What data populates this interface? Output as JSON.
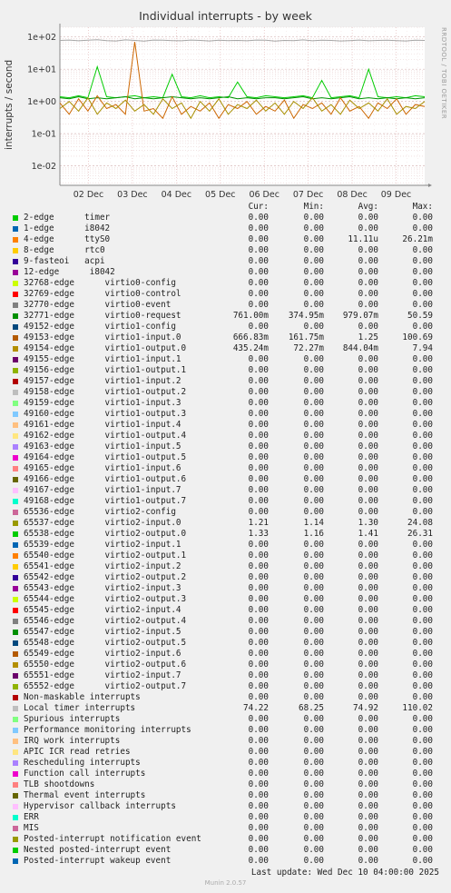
{
  "chart_data": {
    "type": "line",
    "title": "Individual interrupts - by week",
    "ylabel": "interrupts / second",
    "yscale": "log",
    "ylim": [
      0.0025,
      200
    ],
    "y_ticks": [
      {
        "value": 100,
        "label": "1e+02"
      },
      {
        "value": 10,
        "label": "1e+01"
      },
      {
        "value": 1,
        "label": "1e+00"
      },
      {
        "value": 0.1,
        "label": "1e-01"
      },
      {
        "value": 0.01,
        "label": "1e-02"
      }
    ],
    "x_ticks": [
      "02 Dec",
      "03 Dec",
      "04 Dec",
      "05 Dec",
      "06 Dec",
      "07 Dec",
      "08 Dec",
      "09 Dec"
    ],
    "grid": true,
    "series": [
      {
        "name": "Local timer interrupts",
        "color": "#a6a6a6",
        "values": [
          78,
          80,
          76,
          79,
          82,
          77,
          75,
          81,
          78,
          74,
          80,
          79,
          77,
          76,
          80,
          78,
          75,
          79,
          77,
          78,
          76,
          80,
          79,
          74,
          78,
          77,
          81,
          76,
          79,
          78,
          75,
          77,
          80,
          76,
          78,
          79,
          77,
          75,
          79,
          78
        ]
      },
      {
        "name": "65538-edge",
        "color": "#00cc00",
        "values": [
          1.4,
          1.3,
          1.5,
          1.3,
          12,
          1.4,
          1.3,
          1.4,
          1.5,
          1.3,
          1.4,
          1.3,
          7,
          1.4,
          1.3,
          1.5,
          1.3,
          1.4,
          1.3,
          4,
          1.4,
          1.3,
          1.5,
          1.4,
          1.3,
          1.4,
          1.5,
          1.3,
          4.5,
          1.3,
          1.4,
          1.5,
          1.3,
          10,
          1.4,
          1.3,
          1.4,
          1.3,
          1.5,
          1.4
        ]
      },
      {
        "name": "65537-edge",
        "color": "#008f00",
        "values": [
          1.3,
          1.2,
          1.4,
          1.2,
          1.3,
          1.2,
          1.3,
          1.4,
          1.2,
          1.3,
          1.2,
          1.3,
          1.4,
          1.3,
          1.2,
          1.3,
          1.2,
          1.3,
          1.4,
          1.2,
          1.3,
          1.2,
          1.3,
          1.3,
          1.2,
          1.3,
          1.4,
          1.2,
          1.3,
          1.2,
          1.3,
          1.4,
          1.2,
          1.3,
          1.2,
          1.3,
          1.2,
          1.3,
          1.2,
          1.3
        ]
      },
      {
        "name": "49153-edge",
        "color": "#cc6600",
        "values": [
          0.9,
          0.4,
          1.2,
          0.5,
          1.5,
          0.6,
          0.8,
          0.4,
          70,
          0.5,
          0.6,
          0.3,
          1.4,
          0.4,
          0.7,
          0.5,
          0.9,
          0.3,
          0.8,
          0.6,
          1.0,
          0.4,
          0.7,
          0.5,
          1.1,
          0.3,
          0.8,
          0.6,
          0.9,
          0.4,
          1.3,
          0.5,
          0.7,
          0.3,
          0.9,
          0.6,
          1.2,
          0.4,
          0.8,
          0.7
        ]
      },
      {
        "name": "49154-edge",
        "color": "#a88f00",
        "values": [
          0.6,
          1.0,
          0.5,
          1.3,
          0.4,
          0.9,
          0.6,
          1.1,
          0.5,
          0.8,
          0.4,
          1.2,
          0.6,
          0.9,
          0.3,
          1.0,
          0.5,
          1.2,
          0.4,
          0.8,
          0.6,
          1.1,
          0.5,
          0.9,
          0.4,
          1.0,
          0.6,
          1.3,
          0.5,
          0.8,
          0.4,
          1.1,
          0.6,
          0.9,
          0.5,
          1.2,
          0.4,
          0.7,
          0.6,
          1.0
        ]
      },
      {
        "name": "4-edge",
        "color": "#ff8800",
        "values": [
          0,
          0,
          0,
          0,
          0,
          0,
          0,
          0,
          0,
          0.005,
          0,
          0,
          0,
          0,
          0,
          0,
          0,
          0,
          0,
          0,
          0,
          0,
          0,
          0,
          0,
          0,
          0,
          0,
          0,
          0,
          0,
          0,
          0,
          0,
          0,
          0,
          0,
          0,
          0,
          0
        ]
      }
    ]
  },
  "side_text": "RRDTOOL / TOBI OETIKER",
  "legend": {
    "headers": {
      "cur": "Cur:",
      "min": "Min:",
      "avg": "Avg:",
      "max": "Max:"
    },
    "rows": [
      {
        "color": "#00cc00",
        "name": "2-edge      timer",
        "cur": "0.00",
        "min": "0.00",
        "avg": "0.00",
        "max": "0.00"
      },
      {
        "color": "#0066b3",
        "name": "1-edge      i8042",
        "cur": "0.00",
        "min": "0.00",
        "avg": "0.00",
        "max": "0.00"
      },
      {
        "color": "#ff8000",
        "name": "4-edge      ttyS0",
        "cur": "0.00",
        "min": "0.00",
        "avg": "11.11u",
        "max": "26.21m"
      },
      {
        "color": "#ffcc00",
        "name": "8-edge      rtc0",
        "cur": "0.00",
        "min": "0.00",
        "avg": "0.00",
        "max": "0.00"
      },
      {
        "color": "#330099",
        "name": "9-fasteoi   acpi",
        "cur": "0.00",
        "min": "0.00",
        "avg": "0.00",
        "max": "0.00"
      },
      {
        "color": "#990099",
        "name": "12-edge      i8042",
        "cur": "0.00",
        "min": "0.00",
        "avg": "0.00",
        "max": "0.00"
      },
      {
        "color": "#ccff00",
        "name": "32768-edge      virtio0-config",
        "cur": "0.00",
        "min": "0.00",
        "avg": "0.00",
        "max": "0.00"
      },
      {
        "color": "#ff0000",
        "name": "32769-edge      virtio0-control",
        "cur": "0.00",
        "min": "0.00",
        "avg": "0.00",
        "max": "0.00"
      },
      {
        "color": "#808080",
        "name": "32770-edge      virtio0-event",
        "cur": "0.00",
        "min": "0.00",
        "avg": "0.00",
        "max": "0.00"
      },
      {
        "color": "#008f00",
        "name": "32771-edge      virtio0-request",
        "cur": "761.00m",
        "min": "374.95m",
        "avg": "979.07m",
        "max": "50.59"
      },
      {
        "color": "#00487d",
        "name": "49152-edge      virtio1-config",
        "cur": "0.00",
        "min": "0.00",
        "avg": "0.00",
        "max": "0.00"
      },
      {
        "color": "#b35a00",
        "name": "49153-edge      virtio1-input.0",
        "cur": "666.83m",
        "min": "161.75m",
        "avg": "1.25",
        "max": "100.69"
      },
      {
        "color": "#b38f00",
        "name": "49154-edge      virtio1-output.0",
        "cur": "435.24m",
        "min": "72.27m",
        "avg": "844.04m",
        "max": "7.94"
      },
      {
        "color": "#6b006b",
        "name": "49155-edge      virtio1-input.1",
        "cur": "0.00",
        "min": "0.00",
        "avg": "0.00",
        "max": "0.00"
      },
      {
        "color": "#8fb300",
        "name": "49156-edge      virtio1-output.1",
        "cur": "0.00",
        "min": "0.00",
        "avg": "0.00",
        "max": "0.00"
      },
      {
        "color": "#b30000",
        "name": "49157-edge      virtio1-input.2",
        "cur": "0.00",
        "min": "0.00",
        "avg": "0.00",
        "max": "0.00"
      },
      {
        "color": "#bebebe",
        "name": "49158-edge      virtio1-output.2",
        "cur": "0.00",
        "min": "0.00",
        "avg": "0.00",
        "max": "0.00"
      },
      {
        "color": "#80ff80",
        "name": "49159-edge      virtio1-input.3",
        "cur": "0.00",
        "min": "0.00",
        "avg": "0.00",
        "max": "0.00"
      },
      {
        "color": "#80c9ff",
        "name": "49160-edge      virtio1-output.3",
        "cur": "0.00",
        "min": "0.00",
        "avg": "0.00",
        "max": "0.00"
      },
      {
        "color": "#ffc080",
        "name": "49161-edge      virtio1-input.4",
        "cur": "0.00",
        "min": "0.00",
        "avg": "0.00",
        "max": "0.00"
      },
      {
        "color": "#ffe680",
        "name": "49162-edge      virtio1-output.4",
        "cur": "0.00",
        "min": "0.00",
        "avg": "0.00",
        "max": "0.00"
      },
      {
        "color": "#aa80ff",
        "name": "49163-edge      virtio1-input.5",
        "cur": "0.00",
        "min": "0.00",
        "avg": "0.00",
        "max": "0.00"
      },
      {
        "color": "#ee00cc",
        "name": "49164-edge      virtio1-output.5",
        "cur": "0.00",
        "min": "0.00",
        "avg": "0.00",
        "max": "0.00"
      },
      {
        "color": "#ff8080",
        "name": "49165-edge      virtio1-input.6",
        "cur": "0.00",
        "min": "0.00",
        "avg": "0.00",
        "max": "0.00"
      },
      {
        "color": "#666600",
        "name": "49166-edge      virtio1-output.6",
        "cur": "0.00",
        "min": "0.00",
        "avg": "0.00",
        "max": "0.00"
      },
      {
        "color": "#ffbfff",
        "name": "49167-edge      virtio1-input.7",
        "cur": "0.00",
        "min": "0.00",
        "avg": "0.00",
        "max": "0.00"
      },
      {
        "color": "#00ffcc",
        "name": "49168-edge      virtio1-output.7",
        "cur": "0.00",
        "min": "0.00",
        "avg": "0.00",
        "max": "0.00"
      },
      {
        "color": "#cc6699",
        "name": "65536-edge      virtio2-config",
        "cur": "0.00",
        "min": "0.00",
        "avg": "0.00",
        "max": "0.00"
      },
      {
        "color": "#999900",
        "name": "65537-edge      virtio2-input.0",
        "cur": "1.21",
        "min": "1.14",
        "avg": "1.30",
        "max": "24.08"
      },
      {
        "color": "#00cc00",
        "name": "65538-edge      virtio2-output.0",
        "cur": "1.33",
        "min": "1.16",
        "avg": "1.41",
        "max": "26.31"
      },
      {
        "color": "#0066b3",
        "name": "65539-edge      virtio2-input.1",
        "cur": "0.00",
        "min": "0.00",
        "avg": "0.00",
        "max": "0.00"
      },
      {
        "color": "#ff8000",
        "name": "65540-edge      virtio2-output.1",
        "cur": "0.00",
        "min": "0.00",
        "avg": "0.00",
        "max": "0.00"
      },
      {
        "color": "#ffcc00",
        "name": "65541-edge      virtio2-input.2",
        "cur": "0.00",
        "min": "0.00",
        "avg": "0.00",
        "max": "0.00"
      },
      {
        "color": "#330099",
        "name": "65542-edge      virtio2-output.2",
        "cur": "0.00",
        "min": "0.00",
        "avg": "0.00",
        "max": "0.00"
      },
      {
        "color": "#990099",
        "name": "65543-edge      virtio2-input.3",
        "cur": "0.00",
        "min": "0.00",
        "avg": "0.00",
        "max": "0.00"
      },
      {
        "color": "#ccff00",
        "name": "65544-edge      virtio2-output.3",
        "cur": "0.00",
        "min": "0.00",
        "avg": "0.00",
        "max": "0.00"
      },
      {
        "color": "#ff0000",
        "name": "65545-edge      virtio2-input.4",
        "cur": "0.00",
        "min": "0.00",
        "avg": "0.00",
        "max": "0.00"
      },
      {
        "color": "#808080",
        "name": "65546-edge      virtio2-output.4",
        "cur": "0.00",
        "min": "0.00",
        "avg": "0.00",
        "max": "0.00"
      },
      {
        "color": "#008f00",
        "name": "65547-edge      virtio2-input.5",
        "cur": "0.00",
        "min": "0.00",
        "avg": "0.00",
        "max": "0.00"
      },
      {
        "color": "#00487d",
        "name": "65548-edge      virtio2-output.5",
        "cur": "0.00",
        "min": "0.00",
        "avg": "0.00",
        "max": "0.00"
      },
      {
        "color": "#b35a00",
        "name": "65549-edge      virtio2-input.6",
        "cur": "0.00",
        "min": "0.00",
        "avg": "0.00",
        "max": "0.00"
      },
      {
        "color": "#b38f00",
        "name": "65550-edge      virtio2-output.6",
        "cur": "0.00",
        "min": "0.00",
        "avg": "0.00",
        "max": "0.00"
      },
      {
        "color": "#6b006b",
        "name": "65551-edge      virtio2-input.7",
        "cur": "0.00",
        "min": "0.00",
        "avg": "0.00",
        "max": "0.00"
      },
      {
        "color": "#8fb300",
        "name": "65552-edge      virtio2-output.7",
        "cur": "0.00",
        "min": "0.00",
        "avg": "0.00",
        "max": "0.00"
      },
      {
        "color": "#b30000",
        "name": "Non-maskable interrupts",
        "cur": "0.00",
        "min": "0.00",
        "avg": "0.00",
        "max": "0.00"
      },
      {
        "color": "#bebebe",
        "name": "Local timer interrupts",
        "cur": "74.22",
        "min": "68.25",
        "avg": "74.92",
        "max": "110.02"
      },
      {
        "color": "#80ff80",
        "name": "Spurious interrupts",
        "cur": "0.00",
        "min": "0.00",
        "avg": "0.00",
        "max": "0.00"
      },
      {
        "color": "#80c9ff",
        "name": "Performance monitoring interrupts",
        "cur": "0.00",
        "min": "0.00",
        "avg": "0.00",
        "max": "0.00"
      },
      {
        "color": "#ffc080",
        "name": "IRQ work interrupts",
        "cur": "0.00",
        "min": "0.00",
        "avg": "0.00",
        "max": "0.00"
      },
      {
        "color": "#ffe680",
        "name": "APIC ICR read retries",
        "cur": "0.00",
        "min": "0.00",
        "avg": "0.00",
        "max": "0.00"
      },
      {
        "color": "#aa80ff",
        "name": "Rescheduling interrupts",
        "cur": "0.00",
        "min": "0.00",
        "avg": "0.00",
        "max": "0.00"
      },
      {
        "color": "#ee00cc",
        "name": "Function call interrupts",
        "cur": "0.00",
        "min": "0.00",
        "avg": "0.00",
        "max": "0.00"
      },
      {
        "color": "#ff8080",
        "name": "TLB shootdowns",
        "cur": "0.00",
        "min": "0.00",
        "avg": "0.00",
        "max": "0.00"
      },
      {
        "color": "#666600",
        "name": "Thermal event interrupts",
        "cur": "0.00",
        "min": "0.00",
        "avg": "0.00",
        "max": "0.00"
      },
      {
        "color": "#ffbfff",
        "name": "Hypervisor callback interrupts",
        "cur": "0.00",
        "min": "0.00",
        "avg": "0.00",
        "max": "0.00"
      },
      {
        "color": "#00ffcc",
        "name": "ERR",
        "cur": "0.00",
        "min": "0.00",
        "avg": "0.00",
        "max": "0.00"
      },
      {
        "color": "#cc6699",
        "name": "MIS",
        "cur": "0.00",
        "min": "0.00",
        "avg": "0.00",
        "max": "0.00"
      },
      {
        "color": "#999900",
        "name": "Posted-interrupt notification event",
        "cur": "0.00",
        "min": "0.00",
        "avg": "0.00",
        "max": "0.00"
      },
      {
        "color": "#00cc00",
        "name": "Nested posted-interrupt event",
        "cur": "0.00",
        "min": "0.00",
        "avg": "0.00",
        "max": "0.00"
      },
      {
        "color": "#0066b3",
        "name": "Posted-interrupt wakeup event",
        "cur": "0.00",
        "min": "0.00",
        "avg": "0.00",
        "max": "0.00"
      }
    ]
  },
  "last_update": "Last update: Wed Dec 10 04:00:00 2025",
  "munin_version": "Munin 2.0.57"
}
